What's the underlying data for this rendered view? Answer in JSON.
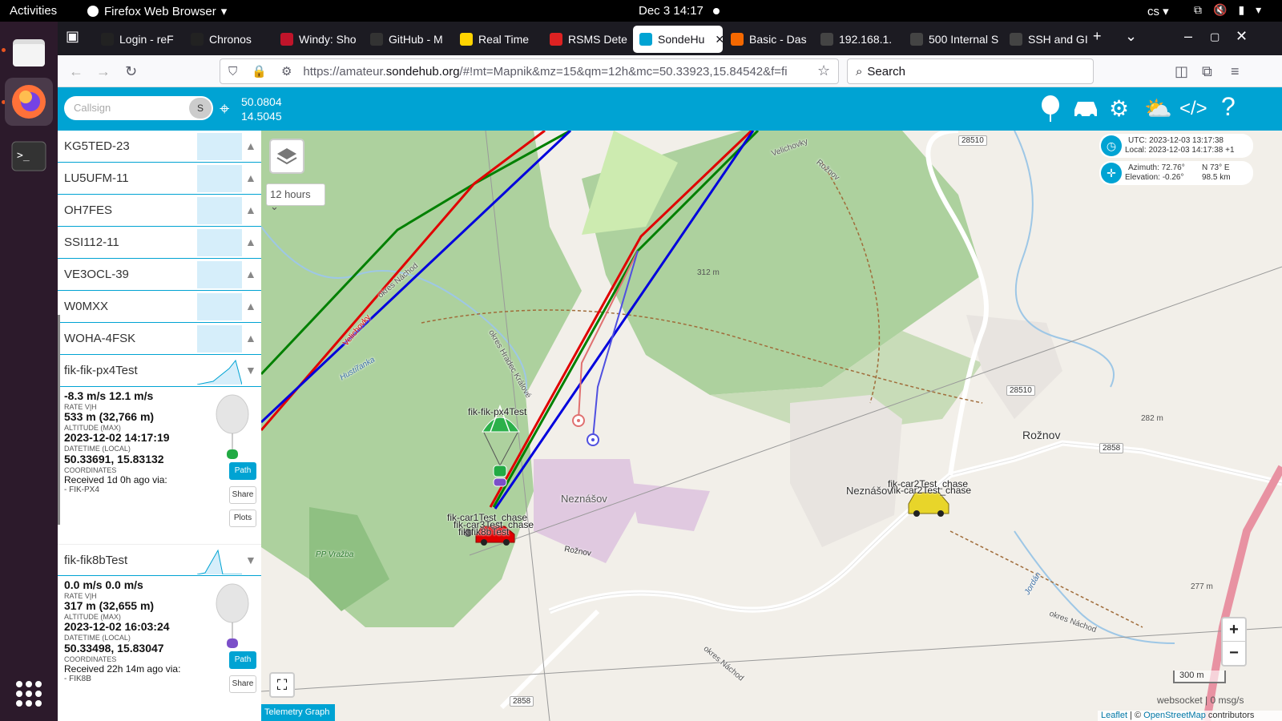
{
  "system": {
    "activities": "Activities",
    "app_name": "Firefox Web Browser",
    "clock": "Dec 3  14:17",
    "lang": "cs"
  },
  "tabs": [
    {
      "label": "Login - reF",
      "color": "#222"
    },
    {
      "label": "Chronos",
      "color": "#222"
    },
    {
      "label": "Windy: Sho",
      "color": "#c0142a"
    },
    {
      "label": "GitHub - M",
      "color": "#333"
    },
    {
      "label": "Real Time",
      "color": "#ffd400"
    },
    {
      "label": "RSMS Dete",
      "color": "#d22"
    },
    {
      "label": "SondeHu",
      "color": "#00a3d3"
    },
    {
      "label": "Basic - Das",
      "color": "#f46800"
    },
    {
      "label": "192.168.1.",
      "color": "#444"
    },
    {
      "label": "500 Internal S",
      "color": "#444"
    },
    {
      "label": "SSH and GI",
      "color": "#444"
    }
  ],
  "nav": {
    "url_prefix": "https://amateur.",
    "url_domain": "sondehub.org",
    "url_rest": "/#!mt=Mapnik&mz=15&qm=12h&mc=50.33923,15.84542&f=fi",
    "search_placeholder": "Search"
  },
  "header": {
    "callsign_placeholder": "Callsign",
    "callsign_btn": "S",
    "lat": "50.0804",
    "lon": "14.5045"
  },
  "sidebar": {
    "list": [
      {
        "name": "KG5TED-23"
      },
      {
        "name": "LU5UFM-11"
      },
      {
        "name": "OH7FES"
      },
      {
        "name": "SSI112-11"
      },
      {
        "name": "VE3OCL-39"
      },
      {
        "name": "W0MXX"
      },
      {
        "name": "WOHA-4FSK"
      }
    ],
    "balloons": [
      {
        "name": "fik-fik-px4Test",
        "rate": "-8.3 m/s 12.1 m/s",
        "rate_label": "RATE V|H",
        "altitude": "533 m (32,766 m)",
        "altitude_label": "ALTITUDE (MAX)",
        "datetime": "2023-12-02 14:17:19",
        "datetime_label": "DATETIME (LOCAL)",
        "coords": "50.33691, 15.83132",
        "coords_label": "COORDINATES",
        "received": "Received 1d 0h ago via:",
        "via": "- FIK-PX4",
        "btn_path": "Path",
        "btn_share": "Share",
        "btn_plots": "Plots",
        "color": "#22aa44"
      },
      {
        "name": "fik-fik8bTest",
        "rate": "0.0 m/s 0.0 m/s",
        "rate_label": "RATE V|H",
        "altitude": "317 m (32,655 m)",
        "altitude_label": "ALTITUDE (MAX)",
        "datetime": "2023-12-02 16:03:24",
        "datetime_label": "DATETIME (LOCAL)",
        "coords": "50.33498, 15.83047",
        "coords_label": "COORDINATES",
        "received": "Received 22h 14m ago via:",
        "via": "- FIK8B",
        "btn_path": "Path",
        "btn_share": "Share",
        "color": "#7b4fc9"
      }
    ]
  },
  "map": {
    "hours": "12 hours",
    "utc": "UTC: 2023-12-03 13:17:38",
    "local": "Local: 2023-12-03 14:17:38 +1",
    "azimuth": "Azimuth: 72.76°",
    "direction": "N 73° E",
    "elevation": "Elevation: -0.26°",
    "distance": "98.5 km",
    "scale": "300 m",
    "websocket": "websocket | 0 msg/s",
    "telemetry": "Telemetry Graph",
    "attrib_leaflet": "Leaflet",
    "attrib_sep": " | © ",
    "attrib_osm": "OpenStreetMap",
    "attrib_contrib": " contributors",
    "marker_px4": "fik-fik-px4Test",
    "marker_cars": "fik-car1Test_chase",
    "marker_cars2": "fik-car3Test_chase",
    "marker_8b": "fik-fik8bTest",
    "marker_car2": "fik-car2Test_chase",
    "marker_car2b": "fik-car2Test_chase",
    "places": {
      "neznasov_a": "Neznášov",
      "neznasov_b": "Neznášov",
      "roznov": "Rožnov",
      "roznov_small": "Rožnov",
      "pp_vrazba": "PP Vražba",
      "hustirenka": "Hustířanka",
      "okres_nachod": "okres Náchod",
      "okres_hk": "okres Hradec Králové",
      "okres_nachod2": "okres Náchod",
      "okres_nachod3": "okres Náchod",
      "velichovky": "Velichovky",
      "velichovky2": "Velichovky",
      "roznov_road": "Rožnov",
      "jordan": "Jordán"
    },
    "roads": {
      "r1": "28510",
      "r2": "28510",
      "r3": "2858",
      "r4": "2858"
    },
    "elevations": {
      "e1": "312 m",
      "e2": "282 m",
      "e3": "277 m"
    }
  }
}
